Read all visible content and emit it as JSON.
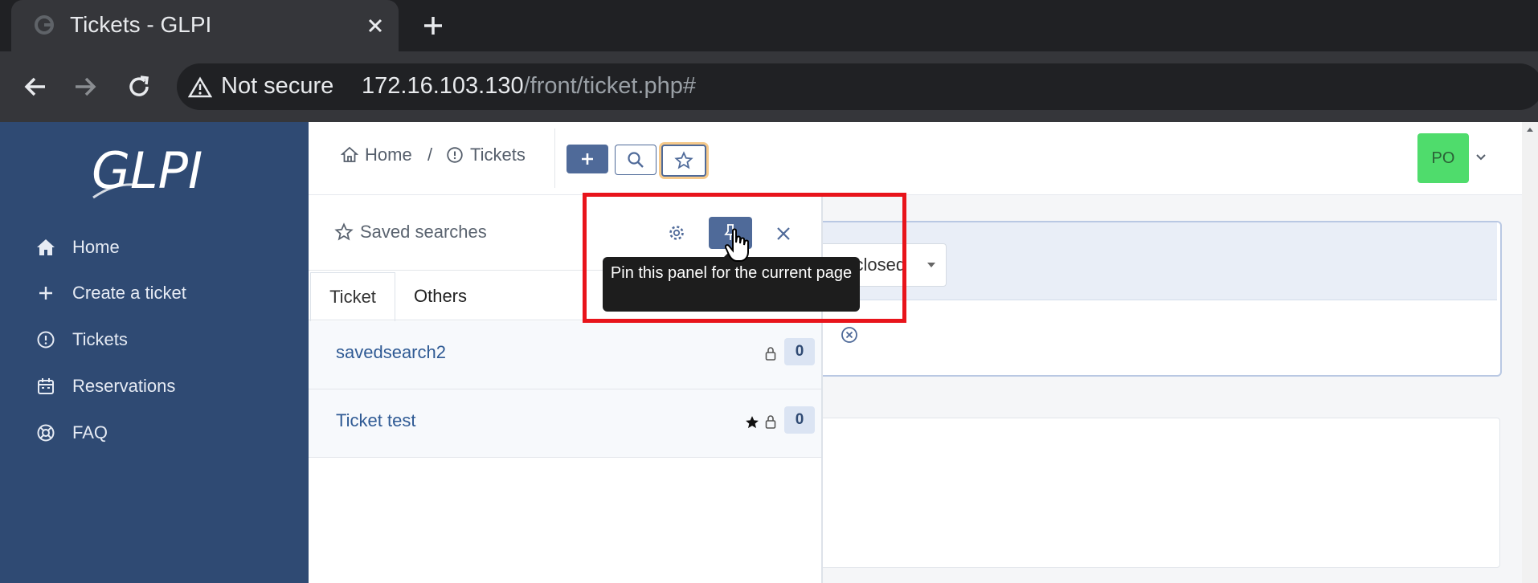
{
  "browser": {
    "tab_title": "Tickets - GLPI",
    "tab_close": "×",
    "new_tab": "+",
    "security_label": "Not secure",
    "url_host": "172.16.103.130",
    "url_path": "/front/ticket.php#"
  },
  "app": {
    "logo": "GLPI",
    "colors": {
      "sidebar": "#2f4a73",
      "accent": "#4f6a99",
      "avatar": "#4fdc6c",
      "highlight": "#e8141b"
    }
  },
  "sidebar": {
    "items": [
      {
        "label": "Home",
        "icon": "home-icon"
      },
      {
        "label": "Create a ticket",
        "icon": "plus-icon"
      },
      {
        "label": "Tickets",
        "icon": "alert-circle-icon"
      },
      {
        "label": "Reservations",
        "icon": "calendar-icon"
      },
      {
        "label": "FAQ",
        "icon": "lifebuoy-icon"
      }
    ]
  },
  "header": {
    "breadcrumb": [
      {
        "label": "Home",
        "icon": "home-outline-icon"
      },
      {
        "separator": "/"
      },
      {
        "label": "Tickets",
        "icon": "alert-circle-icon"
      }
    ],
    "buttons": [
      "add-icon",
      "search-icon",
      "star-icon"
    ],
    "avatar_initials": "PO"
  },
  "criteria": {
    "status_value_partial": "ot closed"
  },
  "saved_searches": {
    "title": "Saved searches",
    "tabs": [
      "Ticket",
      "Others"
    ],
    "items": [
      {
        "name": "savedsearch2",
        "default": false,
        "count": "0"
      },
      {
        "name": "Ticket test",
        "default": true,
        "count": "0"
      }
    ],
    "tooltip": "Pin this panel for the current page"
  }
}
